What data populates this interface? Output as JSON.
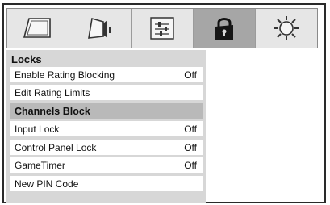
{
  "tabs": [
    {
      "icon": "picture-icon",
      "active": false
    },
    {
      "icon": "audio-icon",
      "active": false
    },
    {
      "icon": "setup-icon",
      "active": false
    },
    {
      "icon": "lock-icon",
      "active": true
    },
    {
      "icon": "options-icon",
      "active": false
    }
  ],
  "menu": {
    "title": "Locks",
    "items": [
      {
        "label": "Enable Rating Blocking",
        "value": "Off"
      },
      {
        "label": "Edit Rating Limits",
        "value": ""
      },
      {
        "label": "Channels Block",
        "value": ""
      },
      {
        "label": "Input Lock",
        "value": "Off"
      },
      {
        "label": "Control Panel Lock",
        "value": "Off"
      },
      {
        "label": "GameTimer",
        "value": "Off"
      },
      {
        "label": "New PIN Code",
        "value": ""
      }
    ]
  }
}
